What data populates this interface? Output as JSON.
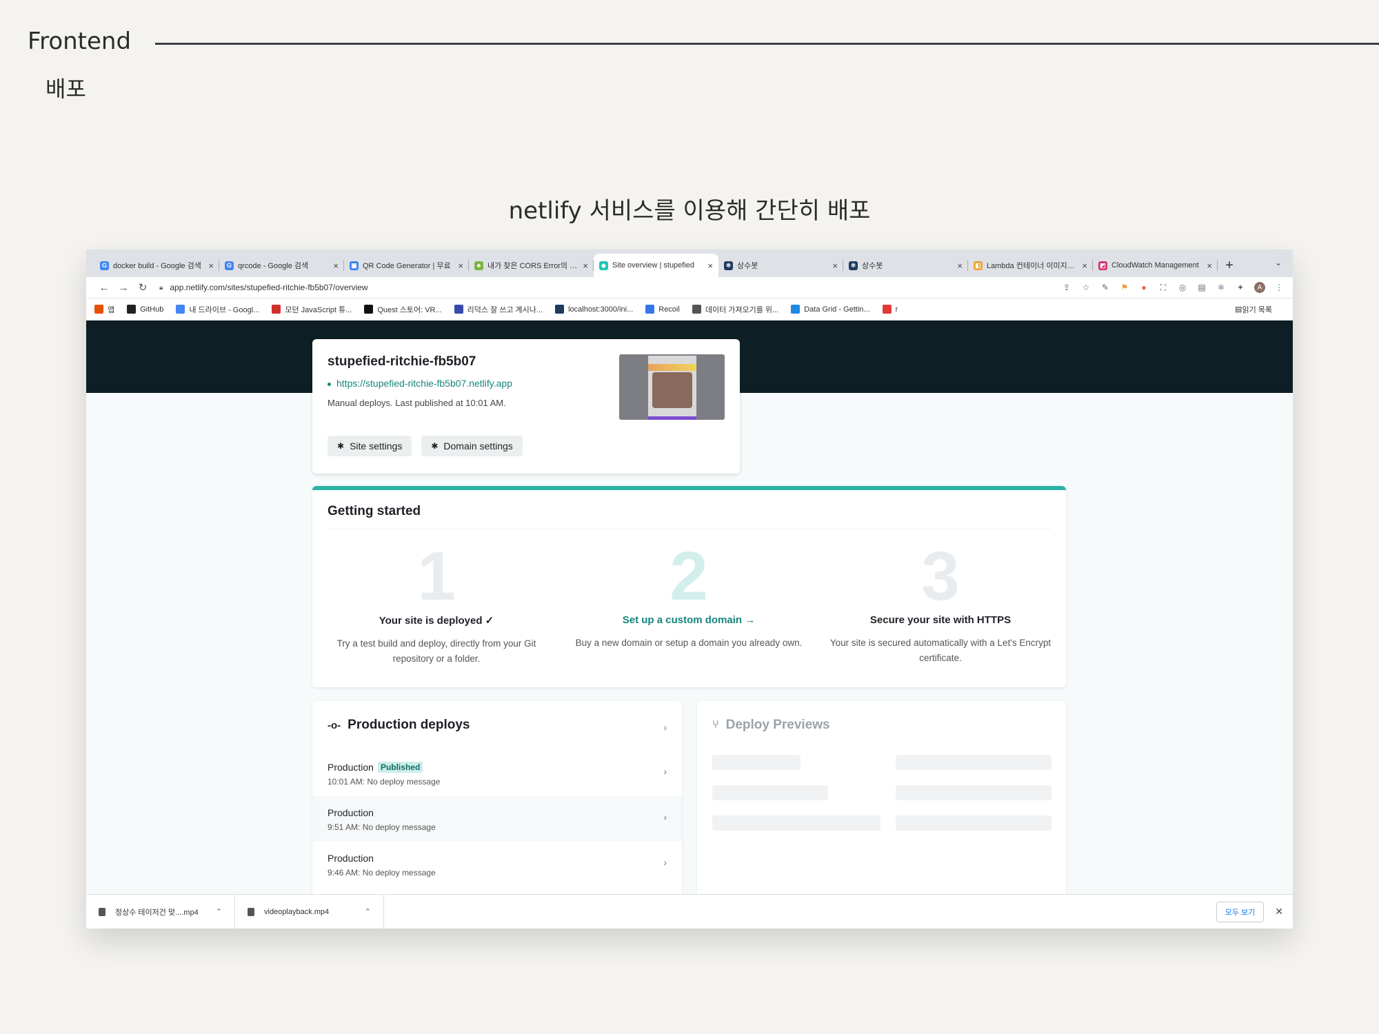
{
  "slide": {
    "title": "Frontend",
    "subtitle": "배포",
    "caption": "netlify 서비스를 이용해 간단히 배포"
  },
  "browser": {
    "tabs": [
      {
        "title": "docker build - Google 검색",
        "icon": "google-icon",
        "color": "#4285f4",
        "glyph": "G",
        "active": false
      },
      {
        "title": "qrcode - Google 검색",
        "icon": "google-icon",
        "color": "#4285f4",
        "glyph": "G",
        "active": false
      },
      {
        "title": "QR Code Generator | 무료",
        "icon": "qr-icon",
        "color": "#3b82f6",
        "glyph": "▣",
        "active": false
      },
      {
        "title": "내가 찾은 CORS Error의 해결",
        "icon": "tree-icon",
        "color": "#7cb342",
        "glyph": "♣",
        "active": false
      },
      {
        "title": "Site overview | stupefied",
        "icon": "netlify-icon",
        "color": "#20c6b7",
        "glyph": "◆",
        "active": true
      },
      {
        "title": "상수봇",
        "icon": "react-icon",
        "color": "#1e3a5f",
        "glyph": "⚛",
        "active": false
      },
      {
        "title": "상수봇",
        "icon": "react-icon",
        "color": "#1e3a5f",
        "glyph": "⚛",
        "active": false
      },
      {
        "title": "Lambda 컨테이너 이미지에서",
        "icon": "aws-icon",
        "color": "#f0a030",
        "glyph": "◧",
        "active": false
      },
      {
        "title": "CloudWatch Management",
        "icon": "cloudwatch-icon",
        "color": "#d6336c",
        "glyph": "◩",
        "active": false
      }
    ],
    "new_tab": "+",
    "address": "app.netlify.com/sites/stupefied-ritchie-fb5b07/overview",
    "bookmarks": [
      {
        "label": "앱",
        "icon": "apps-icon",
        "color": "#e65100"
      },
      {
        "label": "GitHub",
        "icon": "github-icon",
        "color": "#222222"
      },
      {
        "label": "내 드라이브 - Googl...",
        "icon": "google-icon",
        "color": "#4285f4"
      },
      {
        "label": "모던 JavaScript 튜...",
        "icon": "js-icon",
        "color": "#d32f2f"
      },
      {
        "label": "Quest 스토어: VR...",
        "icon": "oculus-icon",
        "color": "#111111"
      },
      {
        "label": "리덕스 잘 쓰고 계시나...",
        "icon": "bookmark-icon",
        "color": "#3949ab"
      },
      {
        "label": "localhost:3000/ini...",
        "icon": "react-icon",
        "color": "#1e3a5f"
      },
      {
        "label": "Recoil",
        "icon": "recoil-icon",
        "color": "#3578e5"
      },
      {
        "label": "데이터 가져오기를 위...",
        "icon": "wave-icon",
        "color": "#555555"
      },
      {
        "label": "Data Grid - Gettin...",
        "icon": "mui-icon",
        "color": "#1e88e5"
      },
      {
        "label": "r",
        "icon": "flag-icon",
        "color": "#e53935"
      }
    ],
    "reading_list": "읽기 목록"
  },
  "site": {
    "name": "stupefied-ritchie-fb5b07",
    "url": "https://stupefied-ritchie-fb5b07.netlify.app",
    "meta": "Manual deploys. Last published at 10:01 AM.",
    "site_settings": "Site settings",
    "domain_settings": "Domain settings"
  },
  "getting_started": {
    "title": "Getting started",
    "steps": [
      {
        "num": "1",
        "head": "Your site is deployed ✓",
        "desc": "Try a test build and deploy, directly from your Git repository or a folder."
      },
      {
        "num": "2",
        "head": "Set up a custom domain →",
        "desc": "Buy a new domain or setup a domain you already own."
      },
      {
        "num": "3",
        "head": "Secure your site with HTTPS",
        "desc": "Your site is secured automatically with a Let's Encrypt certificate."
      }
    ]
  },
  "production": {
    "title": "Production deploys",
    "rows": [
      {
        "label": "Production",
        "badge": "Published",
        "sub": "10:01 AM: No deploy message"
      },
      {
        "label": "Production",
        "badge": "",
        "sub": "9:51 AM: No deploy message"
      },
      {
        "label": "Production",
        "badge": "",
        "sub": "9:46 AM: No deploy message"
      }
    ]
  },
  "previews": {
    "title": "Deploy Previews"
  },
  "downloads": {
    "items": [
      {
        "name": "정상수 테이저건 맞....mp4"
      },
      {
        "name": "videoplayback.mp4"
      }
    ],
    "show_all": "모두 보기"
  },
  "colors": {
    "netlify_teal": "#2ab3a4",
    "hero_dark": "#0e1e25",
    "link_teal": "#15847d"
  }
}
